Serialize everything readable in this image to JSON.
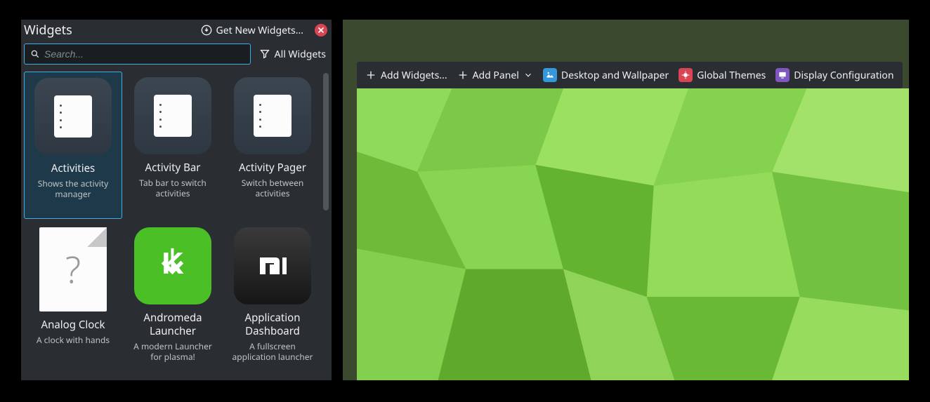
{
  "panel": {
    "title": "Widgets",
    "get_new": "Get New Widgets...",
    "search_placeholder": "Search...",
    "all_widgets": "All Widgets"
  },
  "widgets": [
    {
      "name": "Activities",
      "desc": "Shows the activity manager",
      "icon": "activities",
      "selected": true
    },
    {
      "name": "Activity Bar",
      "desc": "Tab bar to switch activities",
      "icon": "activities",
      "selected": false
    },
    {
      "name": "Activity Pager",
      "desc": "Switch between activities",
      "icon": "activities",
      "selected": false
    },
    {
      "name": "Analog Clock",
      "desc": "A clock with hands",
      "icon": "analog",
      "selected": false
    },
    {
      "name": "Andromeda Launcher",
      "desc": "A modern Launcher for plasma!",
      "icon": "andromeda",
      "selected": false
    },
    {
      "name": "Application Dashboard",
      "desc": "A fullscreen application launcher",
      "icon": "app-dash",
      "selected": false
    }
  ],
  "toolbar": {
    "add_widgets": "Add Widgets...",
    "add_panel": "Add Panel",
    "desktop_wallpaper": "Desktop and Wallpaper",
    "global_themes": "Global Themes",
    "display_config": "Display Configuration"
  }
}
